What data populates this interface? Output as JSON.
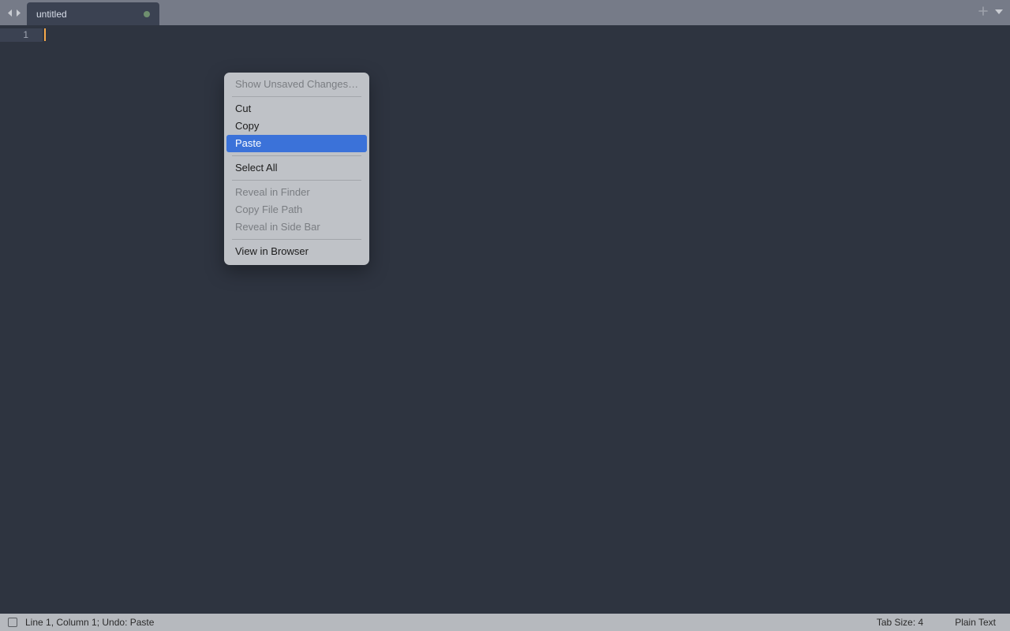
{
  "tabbar": {
    "active_tab_title": "untitled",
    "dirty": true
  },
  "editor": {
    "line_number": "1"
  },
  "context_menu": {
    "items": [
      {
        "label": "Show Unsaved Changes…",
        "enabled": false
      },
      {
        "separator": true
      },
      {
        "label": "Cut",
        "enabled": true
      },
      {
        "label": "Copy",
        "enabled": true
      },
      {
        "label": "Paste",
        "enabled": true,
        "highlight": true
      },
      {
        "separator": true
      },
      {
        "label": "Select All",
        "enabled": true
      },
      {
        "separator": true
      },
      {
        "label": "Reveal in Finder",
        "enabled": false
      },
      {
        "label": "Copy File Path",
        "enabled": false
      },
      {
        "label": "Reveal in Side Bar",
        "enabled": false
      },
      {
        "separator": true
      },
      {
        "label": "View in Browser",
        "enabled": true
      }
    ]
  },
  "statusbar": {
    "position_text": "Line 1, Column 1; Undo: Paste",
    "tab_size_text": "Tab Size: 4",
    "syntax_text": "Plain Text"
  },
  "colors": {
    "editor_bg": "#2e3440",
    "tabbar_bg": "#767b88",
    "statusbar_bg": "#b6b9be",
    "highlight": "#3b72d9",
    "cursor": "#f7a94a"
  }
}
